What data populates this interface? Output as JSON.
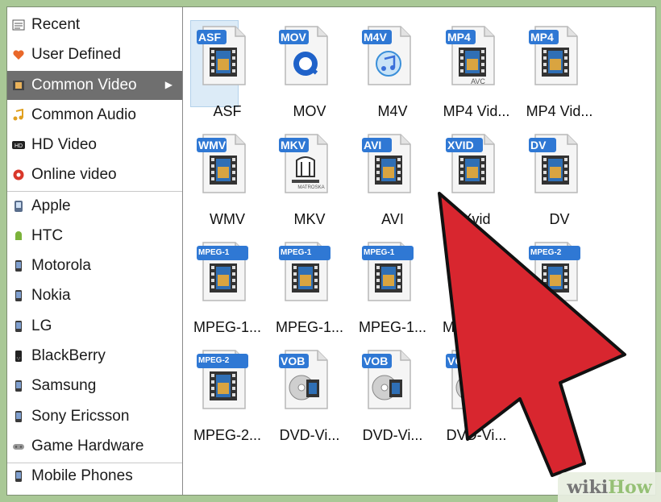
{
  "sidebar": {
    "items": [
      {
        "label": "Recent",
        "icon": "recent-icon"
      },
      {
        "label": "User Defined",
        "icon": "heart-icon"
      },
      {
        "label": "Common Video",
        "icon": "film-icon",
        "selected": true
      },
      {
        "label": "Common Audio",
        "icon": "music-icon"
      },
      {
        "label": "HD Video",
        "icon": "hd-icon"
      },
      {
        "label": "Online video",
        "icon": "online-icon"
      },
      {
        "label": "Apple",
        "icon": "apple-device-icon"
      },
      {
        "label": "HTC",
        "icon": "android-icon"
      },
      {
        "label": "Motorola",
        "icon": "phone-icon"
      },
      {
        "label": "Nokia",
        "icon": "phone-icon"
      },
      {
        "label": "LG",
        "icon": "phone-icon"
      },
      {
        "label": "BlackBerry",
        "icon": "blackberry-icon"
      },
      {
        "label": "Samsung",
        "icon": "phone-icon"
      },
      {
        "label": "Sony Ericsson",
        "icon": "phone-icon"
      },
      {
        "label": "Game Hardware",
        "icon": "gamepad-icon"
      },
      {
        "label": "Mobile Phones",
        "icon": "phone-icon"
      }
    ]
  },
  "formats": [
    {
      "badge": "ASF",
      "label": "ASF",
      "art": "film",
      "selected": true
    },
    {
      "badge": "MOV",
      "label": "MOV",
      "art": "quicktime"
    },
    {
      "badge": "M4V",
      "label": "M4V",
      "art": "itunes"
    },
    {
      "badge": "MP4",
      "label": "MP4 Vid...",
      "art": "film",
      "sub": "AVC"
    },
    {
      "badge": "MP4",
      "label": "MP4 Vid...",
      "art": "film"
    },
    {
      "badge": "WMV",
      "label": "WMV",
      "art": "film"
    },
    {
      "badge": "MKV",
      "label": "MKV",
      "art": "matroska",
      "sub": "MATROSKA"
    },
    {
      "badge": "AVI",
      "label": "AVI",
      "art": "film"
    },
    {
      "badge": "XVID",
      "label": "Xvid",
      "art": "film"
    },
    {
      "badge": "DV",
      "label": "DV",
      "art": "film"
    },
    {
      "badge": "MPEG-1",
      "label": "MPEG-1...",
      "art": "film"
    },
    {
      "badge": "MPEG-1",
      "label": "MPEG-1...",
      "art": "film"
    },
    {
      "badge": "MPEG-1",
      "label": "MPEG-1...",
      "art": "film"
    },
    {
      "badge": "MPEG-2",
      "label": "MPEG-2...",
      "art": "film"
    },
    {
      "badge": "MPEG-2",
      "label": "MPEG-2...",
      "art": "film"
    },
    {
      "badge": "MPEG-2",
      "label": "MPEG-2...",
      "art": "film"
    },
    {
      "badge": "VOB",
      "label": "DVD-Vi...",
      "art": "disc"
    },
    {
      "badge": "VOB",
      "label": "DVD-Vi...",
      "art": "disc"
    },
    {
      "badge": "VOB",
      "label": "DVD-Vi...",
      "art": "disc"
    }
  ],
  "watermark": {
    "part1": "wiki",
    "part2": "How"
  },
  "colors": {
    "badge_blue": "#2f78d4",
    "pointer_red": "#d8262f",
    "selected_row": "#6f6f6f",
    "background_green": "#a9c896"
  }
}
